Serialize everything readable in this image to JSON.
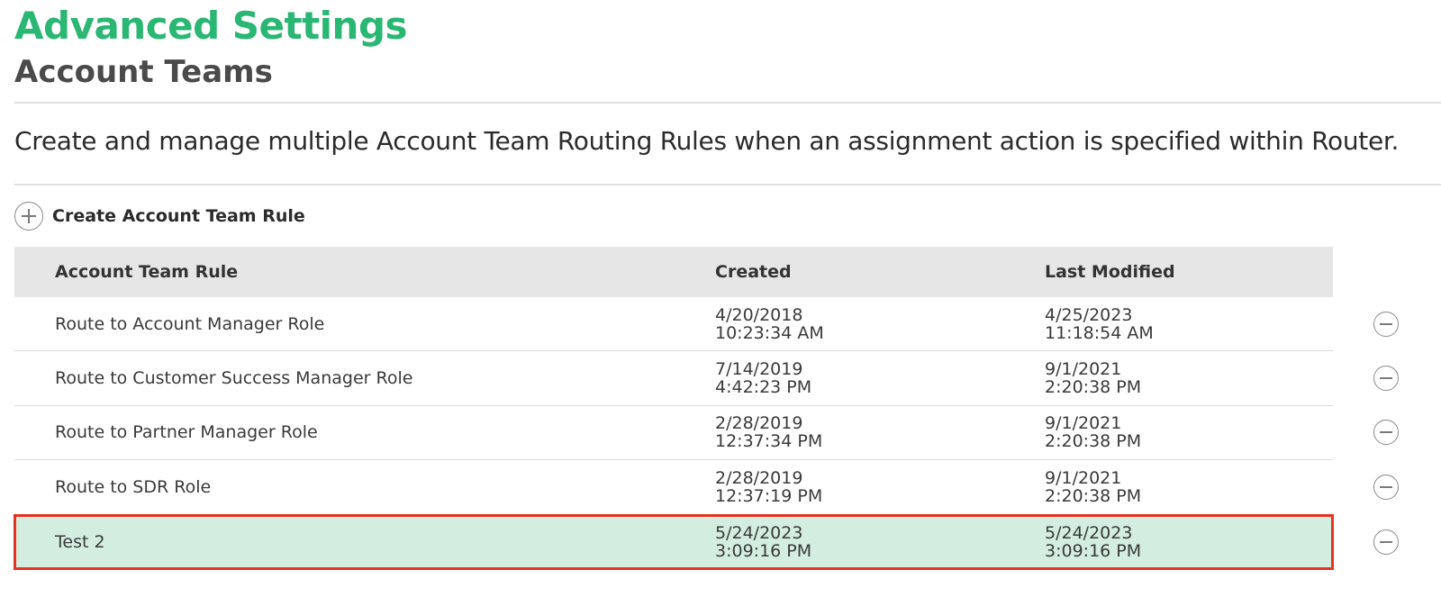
{
  "header": {
    "title": "Advanced Settings",
    "subtitle": "Account Teams",
    "description": "Create and manage multiple Account Team Routing Rules when an assignment action is specified within Router."
  },
  "actions": {
    "create_label": "Create Account Team Rule",
    "create_icon": "plus-circle-icon",
    "remove_icon": "minus-circle-icon"
  },
  "table": {
    "columns": [
      "Account Team Rule",
      "Created",
      "Last Modified"
    ],
    "rows": [
      {
        "name": "Route to Account Manager Role",
        "created_date": "4/20/2018",
        "created_time": "10:23:34 AM",
        "modified_date": "4/25/2023",
        "modified_time": "11:18:54 AM",
        "highlighted": false
      },
      {
        "name": "Route to Customer Success Manager Role",
        "created_date": "7/14/2019",
        "created_time": "4:42:23 PM",
        "modified_date": "9/1/2021",
        "modified_time": "2:20:38 PM",
        "highlighted": false
      },
      {
        "name": "Route to Partner Manager Role",
        "created_date": "2/28/2019",
        "created_time": "12:37:34 PM",
        "modified_date": "9/1/2021",
        "modified_time": "2:20:38 PM",
        "highlighted": false
      },
      {
        "name": "Route to SDR Role",
        "created_date": "2/28/2019",
        "created_time": "12:37:19 PM",
        "modified_date": "9/1/2021",
        "modified_time": "2:20:38 PM",
        "highlighted": false
      },
      {
        "name": "Test 2",
        "created_date": "5/24/2023",
        "created_time": "3:09:16 PM",
        "modified_date": "5/24/2023",
        "modified_time": "3:09:16 PM",
        "highlighted": true
      }
    ]
  },
  "colors": {
    "title": "#2ab673",
    "header_row": "#e6e6e6",
    "highlight_row": "#d3eee1",
    "highlight_border": "#e53323"
  }
}
